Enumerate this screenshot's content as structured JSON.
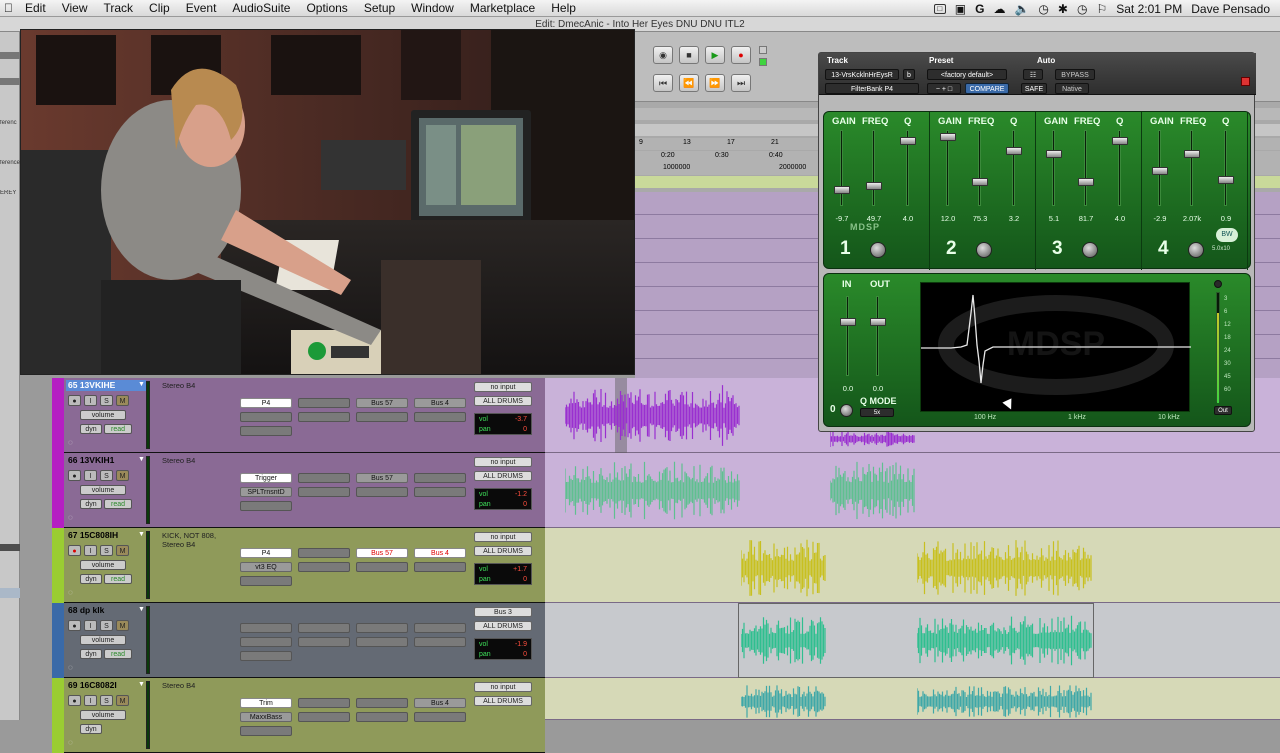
{
  "menubar": {
    "items": [
      "Edit",
      "View",
      "Track",
      "Clip",
      "Event",
      "AudioSuite",
      "Options",
      "Setup",
      "Window",
      "Marketplace",
      "Help"
    ],
    "clock": "Sat 2:01 PM",
    "user": "Dave Pensado"
  },
  "window": {
    "title": "Edit: DmecAnic - Into Her Eyes DNU  DNU  ITL2"
  },
  "left_labels": [
    "ferenc",
    "ference",
    "EREY"
  ],
  "ruler": {
    "bars": [
      "9",
      "13",
      "17",
      "21"
    ],
    "times": [
      "0:20",
      "0:30",
      "0:40"
    ],
    "samples": [
      "1000000",
      "2000000"
    ]
  },
  "plugin": {
    "header": {
      "track_label": "Track",
      "preset_label": "Preset",
      "auto_label": "Auto",
      "track_name": "13-VrsKcklnHrEysR",
      "track_btn": "b",
      "preset_name": "<factory default>",
      "plugin_name": "FilterBank P4",
      "compare": "COMPARE",
      "safe": "SAFE",
      "bypass": "BYPASS",
      "native": "Native"
    },
    "eq_bands": [
      {
        "num": "1",
        "gain_label": "GAIN",
        "freq_label": "FREQ",
        "q_label": "Q",
        "gain": "-9.7",
        "freq": "49.7",
        "q": "4.0",
        "gain_pos": 0.82,
        "freq_pos": 0.76,
        "q_pos": 0.1
      },
      {
        "num": "2",
        "gain_label": "GAIN",
        "freq_label": "FREQ",
        "q_label": "Q",
        "gain": "12.0",
        "freq": "75.3",
        "q": "3.2",
        "gain_pos": 0.05,
        "freq_pos": 0.7,
        "q_pos": 0.25
      },
      {
        "num": "3",
        "gain_label": "GAIN",
        "freq_label": "FREQ",
        "q_label": "Q",
        "gain": "5.1",
        "freq": "81.7",
        "q": "4.0",
        "gain_pos": 0.3,
        "freq_pos": 0.7,
        "q_pos": 0.1
      },
      {
        "num": "4",
        "gain_label": "GAIN",
        "freq_label": "FREQ",
        "q_label": "Q",
        "gain": "-2.9",
        "freq": "2.07k",
        "q": "0.9",
        "gain_pos": 0.55,
        "freq_pos": 0.3,
        "q_pos": 0.68
      }
    ],
    "brand": "MDSP",
    "version": "5.0x10",
    "io": {
      "in_label": "IN",
      "out_label": "OUT",
      "in_val": "0.0",
      "out_val": "0.0",
      "qmode": "Q MODE",
      "qmode_btn": "5x"
    },
    "scope_labels": [
      "100 Hz",
      "1 kHz",
      "10 kHz"
    ],
    "meter_ticks": [
      "3",
      "6",
      "12",
      "18",
      "24",
      "30",
      "45",
      "60"
    ],
    "out_label": "Out",
    "colors": {
      "panel": "#1f7a25",
      "accent": "#e8ffe8"
    }
  },
  "tracks": [
    {
      "name": "65 13VKIHE",
      "selected": true,
      "color": "#b51fc2",
      "stereo": "Stereo B4",
      "inserts": [
        "P4",
        ""
      ],
      "sends": [
        "Bus 57",
        "Bus 4"
      ],
      "input": "no input",
      "output": "ALL DRUMS",
      "vol": "-3.7",
      "pan": "0",
      "mode": "read",
      "rec": false
    },
    {
      "name": "66 13VKIH1",
      "selected": false,
      "color": "#b51fc2",
      "stereo": "Stereo B4",
      "inserts": [
        "Trigger",
        "SPLTrnsntD"
      ],
      "sends": [
        "Bus 57",
        ""
      ],
      "input": "no input",
      "output": "ALL DRUMS",
      "vol": "-1.2",
      "pan": "0",
      "mode": "read",
      "rec": false
    },
    {
      "name": "67 15C808IH",
      "selected": false,
      "color": "#9acd32",
      "stereo": "KICK, NOT 808, Stereo B4",
      "inserts": [
        "P4",
        "vt3 EQ"
      ],
      "sends": [
        "Bus 57",
        "Bus 4"
      ],
      "input": "no input",
      "output": "ALL DRUMS",
      "vol": "+1.7",
      "pan": "0",
      "mode": "read",
      "rec": true
    },
    {
      "name": "68  dp klk",
      "selected": false,
      "color": "#3a6aa8",
      "stereo": "",
      "inserts": [
        "",
        ""
      ],
      "sends": [
        "",
        ""
      ],
      "input": "Bus 3",
      "output": "ALL DRUMS",
      "vol": "-1.9",
      "pan": "0",
      "mode": "read",
      "rec": false
    },
    {
      "name": "69 16C8082I",
      "selected": false,
      "color": "#9acd32",
      "stereo": "Stereo B4",
      "inserts": [
        "Trim",
        "MaxxBass"
      ],
      "sends": [
        "",
        "Bus 4"
      ],
      "input": "no input",
      "output": "ALL DRUMS",
      "vol": "",
      "pan": "",
      "mode": "",
      "rec": false
    }
  ],
  "strip_labels": {
    "volume": "volume",
    "dyn": "dyn",
    "vol": "vol",
    "pan": "pan",
    "i": "I",
    "s": "S",
    "m": "M",
    "rec": "●"
  }
}
